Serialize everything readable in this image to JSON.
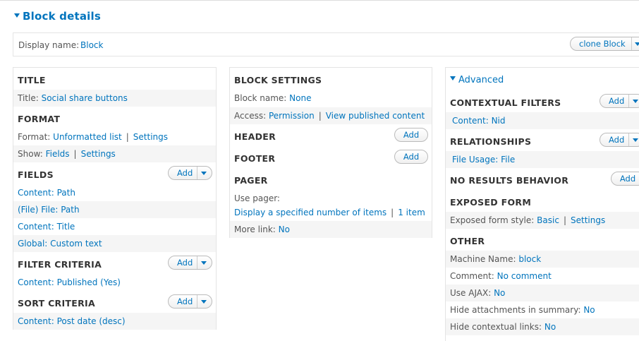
{
  "section_title": "Block details",
  "display": {
    "label": "Display name:",
    "value": "Block",
    "clone_button": "clone Block"
  },
  "col1": {
    "title": {
      "heading": "TITLE",
      "label": "Title:",
      "value": "Social share buttons"
    },
    "format": {
      "heading": "FORMAT",
      "format_label": "Format:",
      "format_value": "Unformatted list",
      "format_settings": "Settings",
      "show_label": "Show:",
      "show_value": "Fields",
      "show_settings": "Settings"
    },
    "fields": {
      "heading": "FIELDS",
      "add": "Add",
      "items": [
        "Content: Path",
        "(File) File: Path",
        "Content: Title",
        "Global: Custom text"
      ]
    },
    "filter": {
      "heading": "FILTER CRITERIA",
      "add": "Add",
      "items": [
        "Content: Published (Yes)"
      ]
    },
    "sort": {
      "heading": "SORT CRITERIA",
      "add": "Add",
      "items": [
        "Content: Post date (desc)"
      ]
    }
  },
  "col2": {
    "block_settings": {
      "heading": "BLOCK SETTINGS",
      "name_label": "Block name:",
      "name_value": "None",
      "access_label": "Access:",
      "access_value": "Permission",
      "access_value2": "View published content"
    },
    "header": {
      "heading": "HEADER",
      "add": "Add"
    },
    "footer": {
      "heading": "FOOTER",
      "add": "Add"
    },
    "pager": {
      "heading": "PAGER",
      "use_label": "Use pager:",
      "use_value": "Display a specified number of items",
      "use_value2": "1 item",
      "more_label": "More link:",
      "more_value": "No"
    }
  },
  "col3": {
    "advanced": "Advanced",
    "contextual": {
      "heading": "CONTEXTUAL FILTERS",
      "add": "Add",
      "items": [
        "Content: Nid"
      ]
    },
    "relationships": {
      "heading": "RELATIONSHIPS",
      "add": "Add",
      "items": [
        "File Usage: File"
      ]
    },
    "no_results": {
      "heading": "NO RESULTS BEHAVIOR",
      "add": "Add"
    },
    "exposed": {
      "heading": "EXPOSED FORM",
      "label": "Exposed form style:",
      "value": "Basic",
      "settings": "Settings"
    },
    "other": {
      "heading": "OTHER",
      "machine_label": "Machine Name:",
      "machine_value": "block",
      "comment_label": "Comment:",
      "comment_value": "No comment",
      "ajax_label": "Use AJAX:",
      "ajax_value": "No",
      "hide_attach_label": "Hide attachments in summary:",
      "hide_attach_value": "No",
      "hide_ctx_label": "Hide contextual links:",
      "hide_ctx_value": "No"
    }
  }
}
